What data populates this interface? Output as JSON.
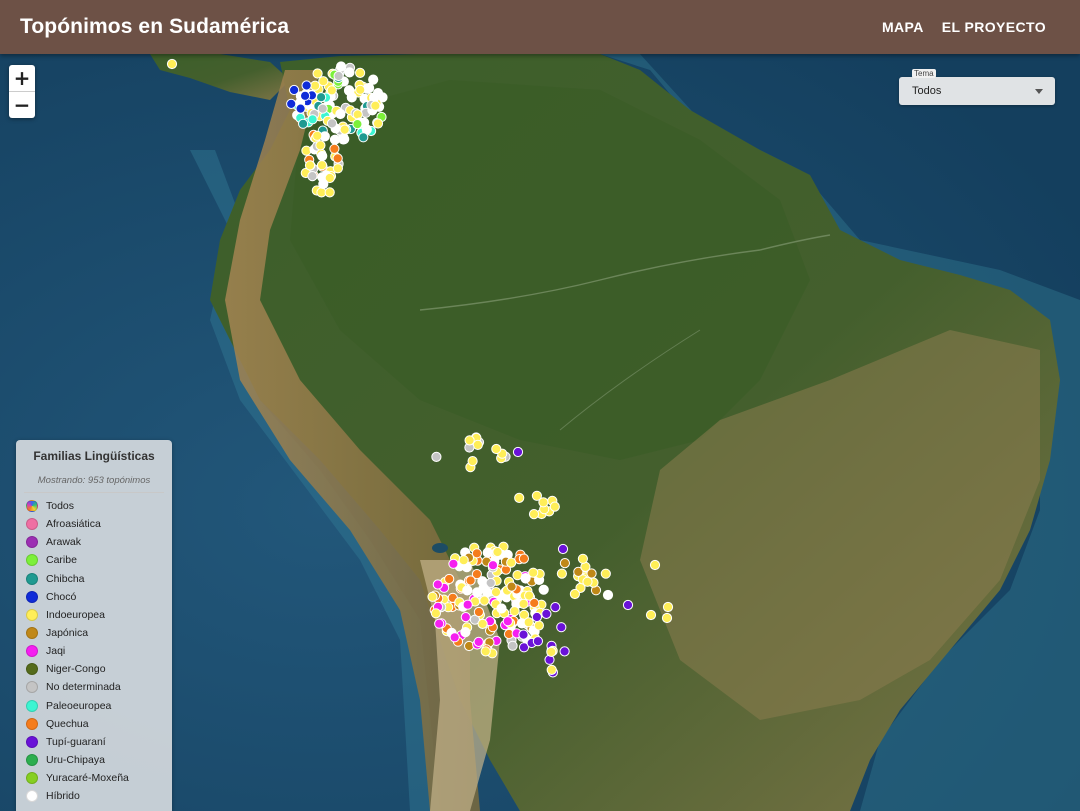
{
  "header": {
    "title": "Topónimos en Sudamérica",
    "nav": [
      {
        "label": "MAPA"
      },
      {
        "label": "EL PROYECTO"
      }
    ]
  },
  "zoom": {
    "in": "+",
    "out": "−"
  },
  "theme": {
    "label": "Tema",
    "value": "Todos"
  },
  "legend": {
    "title": "Familias Lingüísticas",
    "subtitle": "Mostrando: 953 topónimos",
    "items": [
      {
        "label": "Todos",
        "color": "conic"
      },
      {
        "label": "Afroasiática",
        "color": "#ef6fa3"
      },
      {
        "label": "Arawak",
        "color": "#9c2fb3"
      },
      {
        "label": "Caribe",
        "color": "#7cf03a"
      },
      {
        "label": "Chibcha",
        "color": "#1f9a91"
      },
      {
        "label": "Chocó",
        "color": "#0f2bd8"
      },
      {
        "label": "Indoeuropea",
        "color": "#ffee58"
      },
      {
        "label": "Japónica",
        "color": "#c08818"
      },
      {
        "label": "Jaqi",
        "color": "#f51ff0"
      },
      {
        "label": "Niger-Congo",
        "color": "#556b1b"
      },
      {
        "label": "No determinada",
        "color": "#c4c4c4"
      },
      {
        "label": "Paleoeuropea",
        "color": "#3cf5d2"
      },
      {
        "label": "Quechua",
        "color": "#f57c1c"
      },
      {
        "label": "Tupí-guaraní",
        "color": "#6a12d8"
      },
      {
        "label": "Uru-Chipaya",
        "color": "#2cae4f"
      },
      {
        "label": "Yuracaré-Moxeña",
        "color": "#86cf22"
      },
      {
        "label": "Híbrido",
        "color": "#ffffff"
      }
    ]
  }
}
